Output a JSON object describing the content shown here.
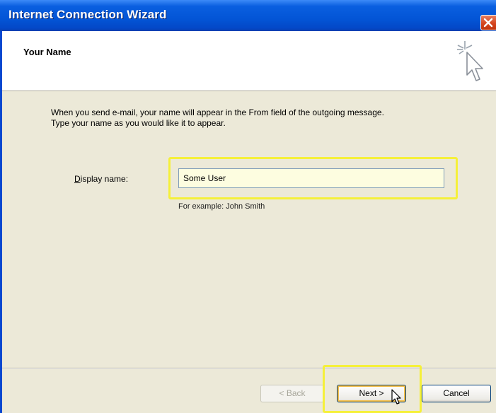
{
  "window": {
    "title": "Internet Connection Wizard",
    "close_icon": "close-icon"
  },
  "header": {
    "title": "Your Name",
    "icon": "wizard-sparkle-cursor-icon"
  },
  "content": {
    "intro": "When you send e-mail, your name will appear in the From field of the outgoing message.\nType your name as you would like it to appear.",
    "display_name": {
      "label_mnemonic": "D",
      "label_rest": "isplay name:",
      "value": "Some User",
      "example": "For example: John Smith"
    }
  },
  "buttons": {
    "back": "< Back",
    "next": "Next >",
    "cancel": "Cancel"
  },
  "colors": {
    "title_bar": "#0355d6",
    "dialog_bg": "#ece9d8",
    "highlight": "#f5f03a"
  }
}
